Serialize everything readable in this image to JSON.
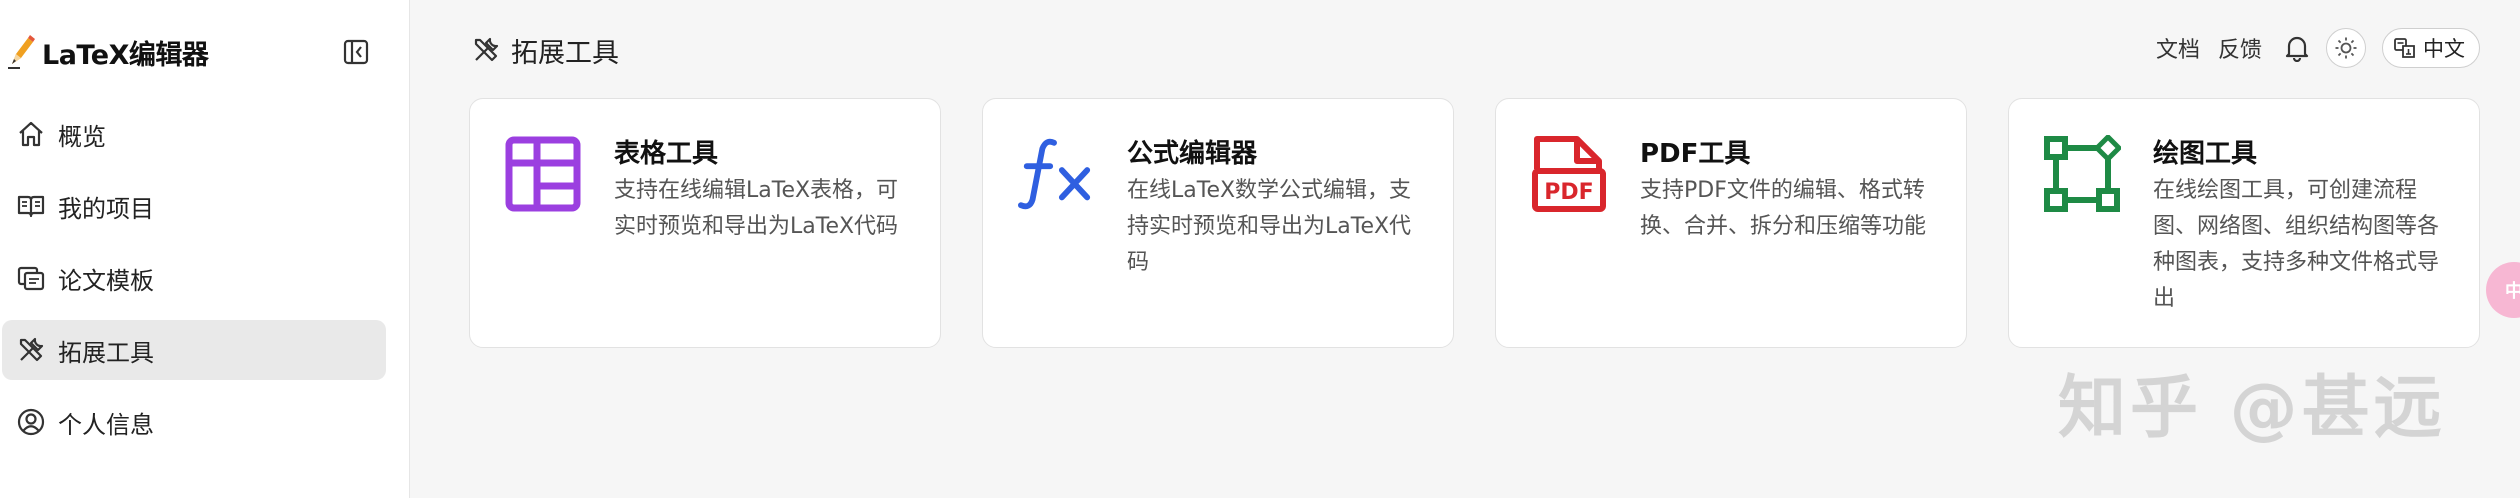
{
  "app": {
    "title": "LaTeX编辑器"
  },
  "sidebar": {
    "items": [
      {
        "label": "概览",
        "icon": "home-icon",
        "active": false
      },
      {
        "label": "我的项目",
        "icon": "book-icon",
        "active": false
      },
      {
        "label": "论文模板",
        "icon": "templates-icon",
        "active": false
      },
      {
        "label": "拓展工具",
        "icon": "tools-icon",
        "active": true
      },
      {
        "label": "个人信息",
        "icon": "user-icon",
        "active": false
      }
    ]
  },
  "header": {
    "title": "拓展工具",
    "links": {
      "docs": "文档",
      "feedback": "反馈"
    },
    "language": "中文"
  },
  "cards": [
    {
      "title": "表格工具",
      "description": "支持在线编辑LaTeX表格，可实时预览和导出为LaTeX代码",
      "icon": "table-icon",
      "color": "#9b3fe0"
    },
    {
      "title": "公式编辑器",
      "description": "在线LaTeX数学公式编辑，支持实时预览和导出为LaTeX代码",
      "icon": "function-icon",
      "color": "#2f5fe0"
    },
    {
      "title": "PDF工具",
      "description": "支持PDF文件的编辑、格式转换、合并、拆分和压缩等功能",
      "icon": "pdf-icon",
      "color": "#d9262c"
    },
    {
      "title": "绘图工具",
      "description": "在线绘图工具，可创建流程图、网络图、组织结构图等各种图表，支持多种文件格式导出",
      "icon": "diagram-icon",
      "color": "#1e8a45"
    }
  ],
  "watermark": "知乎 @甚远",
  "float_ball": "中"
}
